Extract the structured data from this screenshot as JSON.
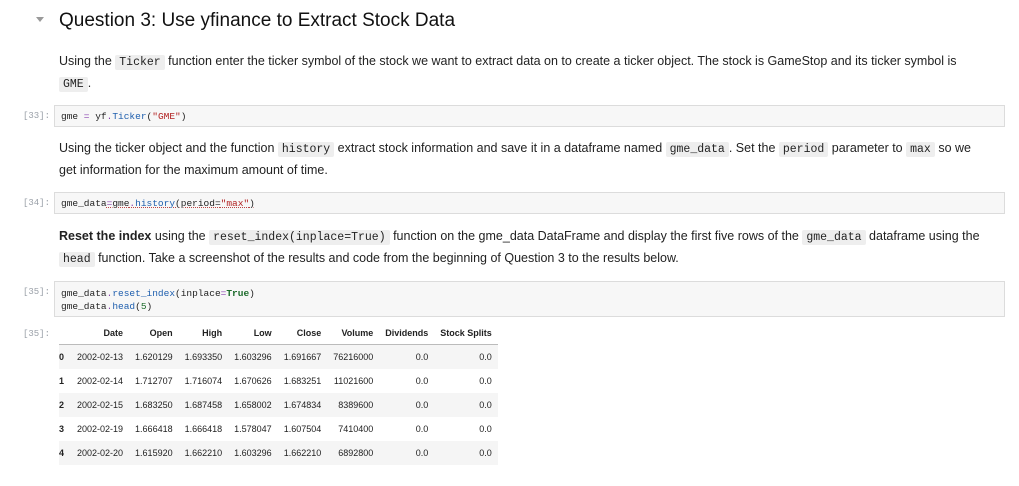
{
  "heading": "Question 3: Use yfinance to Extract Stock Data",
  "p1": {
    "t1": "Using the ",
    "c1": "Ticker",
    "t2": " function enter the ticker symbol of the stock we want to extract data on to create a ticker object. The stock is GameStop and its ticker symbol is ",
    "c2": "GME",
    "t3": "."
  },
  "cell33": {
    "prompt": "[33]:",
    "var": "gme",
    "eq": " = ",
    "obj": "yf",
    "dot": ".",
    "fn": "Ticker",
    "open": "(",
    "arg": "\"GME\"",
    "close": ")"
  },
  "p2": {
    "t1": "Using the ticker object and the function ",
    "c1": "history",
    "t2": " extract stock information and save it in a dataframe named ",
    "c2": "gme_data",
    "t3": ". Set the ",
    "c3": "period",
    "t4": " parameter to ",
    "c4": "max",
    "t5": " so we get information for the maximum amount of time."
  },
  "cell34": {
    "prompt": "[34]:",
    "pre": "gme_data",
    "eq": "=",
    "obj": "gme",
    "dot": ".",
    "fn": "history",
    "open": "(period=",
    "arg": "\"max\"",
    "close": ")"
  },
  "p3": {
    "b1": "Reset the index",
    "t1": " using the ",
    "c1": "reset_index(inplace=True)",
    "t2": " function on the gme_data DataFrame and display the first five rows of the ",
    "c2": "gme_data",
    "t3": " dataframe using the ",
    "c3": "head",
    "t4": " function. Take a screenshot of the results and code from the beginning of Question 3 to the results below."
  },
  "cell35": {
    "prompt": "[35]:",
    "l1a": "gme_data",
    "l1b": ".",
    "l1c": "reset_index",
    "l1d": "(inplace",
    "l1e": "=",
    "l1f": "True",
    "l1g": ")",
    "l2a": "gme_data",
    "l2b": ".",
    "l2c": "head",
    "l2d": "(",
    "l2e": "5",
    "l2f": ")"
  },
  "out35": {
    "prompt": "[35]:"
  },
  "table": {
    "columns": [
      "",
      "Date",
      "Open",
      "High",
      "Low",
      "Close",
      "Volume",
      "Dividends",
      "Stock Splits"
    ],
    "rows": [
      [
        "0",
        "2002-02-13",
        "1.620129",
        "1.693350",
        "1.603296",
        "1.691667",
        "76216000",
        "0.0",
        "0.0"
      ],
      [
        "1",
        "2002-02-14",
        "1.712707",
        "1.716074",
        "1.670626",
        "1.683251",
        "11021600",
        "0.0",
        "0.0"
      ],
      [
        "2",
        "2002-02-15",
        "1.683250",
        "1.687458",
        "1.658002",
        "1.674834",
        "8389600",
        "0.0",
        "0.0"
      ],
      [
        "3",
        "2002-02-19",
        "1.666418",
        "1.666418",
        "1.578047",
        "1.607504",
        "7410400",
        "0.0",
        "0.0"
      ],
      [
        "4",
        "2002-02-20",
        "1.615920",
        "1.662210",
        "1.603296",
        "1.662210",
        "6892800",
        "0.0",
        "0.0"
      ]
    ]
  }
}
